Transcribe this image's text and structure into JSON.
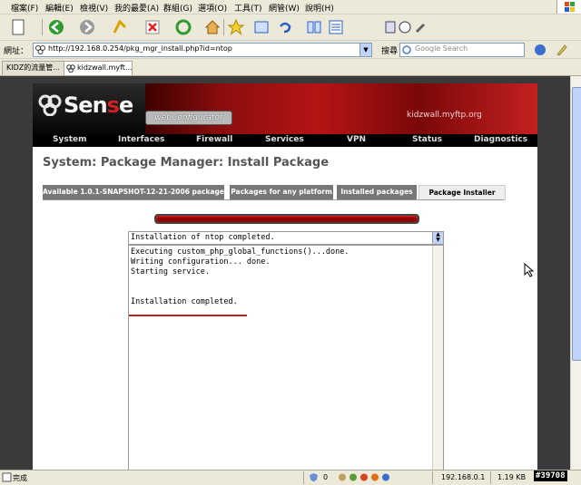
{
  "menu": [
    "檔案(F)",
    "編輯(E)",
    "檢視(V)",
    "我的最愛(A)",
    "群組(G)",
    "選項(O)",
    "工具(T)",
    "網管(W)",
    "說明(H)"
  ],
  "toolbar_icons": [
    "new-page-icon",
    "back-icon",
    "forward-icon",
    "go-icon",
    "stop-icon",
    "refresh-icon",
    "home-icon",
    "favorites-icon",
    "window-icon",
    "undo-icon",
    "group-icon",
    "list-icon",
    "page-icon",
    "compass-icon",
    "tools-icon"
  ],
  "address": {
    "label": "網址：",
    "url": "http://192.168.0.254/pkg_mgr_install.php?id=ntop"
  },
  "search": {
    "label": "搜尋",
    "placeholder": "Google Search"
  },
  "tabs": [
    {
      "label": "KIDZ的流量管..."
    },
    {
      "label": "kidzwall.myft..."
    }
  ],
  "header": {
    "logo": "Sense",
    "subtitle": "webConfigurator",
    "hostname": "kidzwall.myftp.org"
  },
  "nav": [
    "System",
    "Interfaces",
    "Firewall",
    "Services",
    "VPN",
    "Status",
    "Diagnostics"
  ],
  "page_title": "System: Package Manager: Install Package",
  "pkg_tabs": [
    {
      "label": "Available 1.0.1-SNAPSHOT-12-21-2006 packages"
    },
    {
      "label": "Packages for any platform"
    },
    {
      "label": "Installed packages"
    },
    {
      "label": "Package Installer"
    }
  ],
  "active_pkg_tab": 3,
  "status_line": "Installation of ntop completed.",
  "output_lines": [
    "Executing custom_php_global_functions()...done.",
    "Writing configuration... done.",
    "Starting service.",
    "",
    "Installation completed."
  ],
  "statusbar": {
    "status": "完成",
    "count": "0",
    "ip": "192.168.0.1",
    "size": "1.19 KB",
    "watermark": "#39708"
  },
  "colors": {
    "accent": "#b41414",
    "chrome": "#ece9d8",
    "nav_bg": "#000000"
  }
}
